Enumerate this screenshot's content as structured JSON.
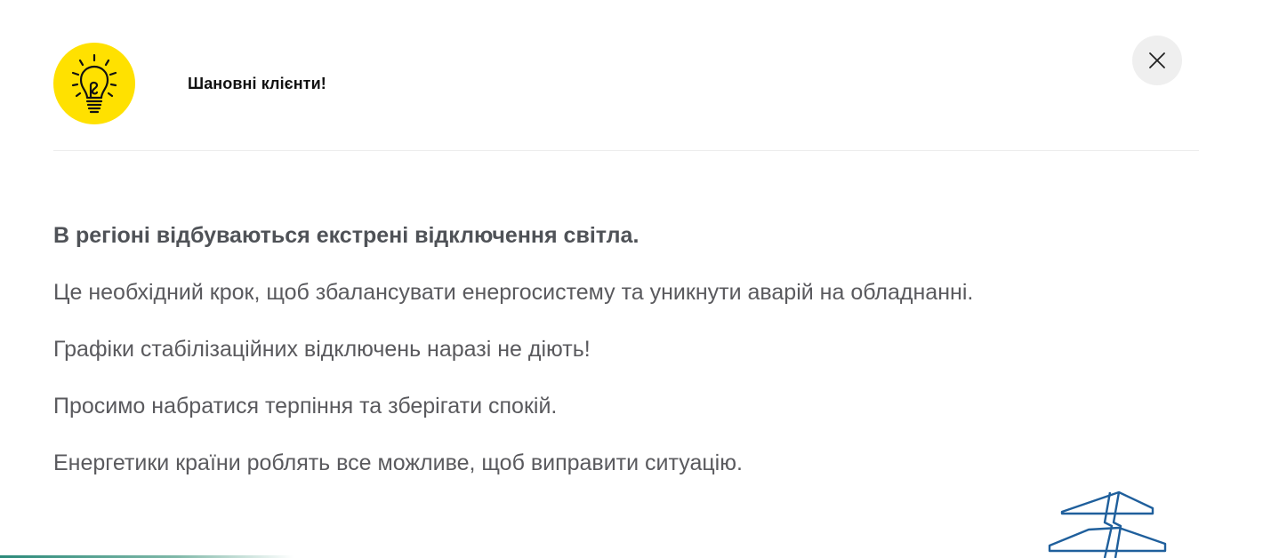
{
  "dialog": {
    "title": "Шановні клієнти!",
    "icon": "lightbulb-icon",
    "close_icon": "close-icon",
    "accent_color": "#ffe100"
  },
  "message": {
    "lead": "В регіоні відбуваються екстрені відключення світла.",
    "paragraphs": [
      "Це необхідний крок, щоб збалансувати енергосистему та уникнути аварій на обладнанні.",
      "Графіки стабілізаційних відключень наразі не діють!",
      "Просимо набратися терпіння та зберігати спокій.",
      "Енергетики країни роблять все можливе, щоб виправити ситуацію."
    ]
  },
  "decoration": {
    "illustration": "power-pylon-icon",
    "pylon_color": "#1f5f9c"
  }
}
